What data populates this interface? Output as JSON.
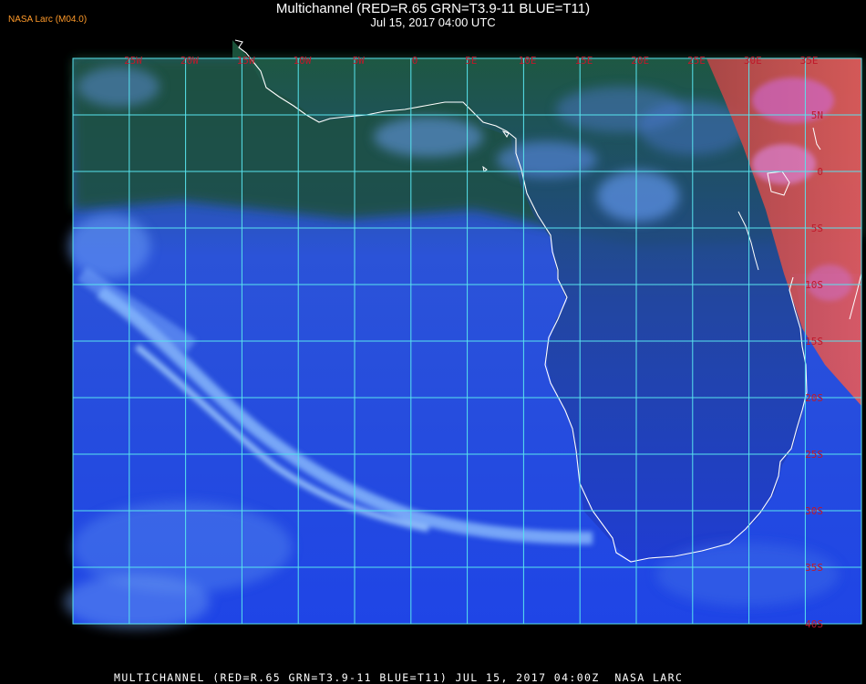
{
  "header": {
    "title": "Multichannel (RED=R.65 GRN=T3.9-11 BLUE=T11)",
    "subtitle": "Jul 15, 2017 04:00 UTC",
    "credit": "NASA Larc (M04.0)"
  },
  "map": {
    "longitude_labels": [
      "25W",
      "20W",
      "15W",
      "10W",
      "5W",
      "0",
      "5E",
      "10E",
      "15E",
      "20E",
      "25E",
      "30E",
      "35E"
    ],
    "latitude_labels": [
      "5N",
      "0",
      "5S",
      "10S",
      "15S",
      "20S",
      "25S",
      "30S",
      "35S",
      "40S"
    ],
    "colors": {
      "grid": "#58e4ee",
      "label": "#c0182a",
      "coastline": "#ffffff",
      "ocean": "#1f45e6",
      "land": "#1c5a3a",
      "cloud": "#7fb2ff",
      "night_edge": "#e04848"
    }
  },
  "footer": {
    "caption": "MULTICHANNEL (RED=R.65 GRN=T3.9-11 BLUE=T11) JUL 15, 2017 04:00Z  NASA LARC"
  }
}
